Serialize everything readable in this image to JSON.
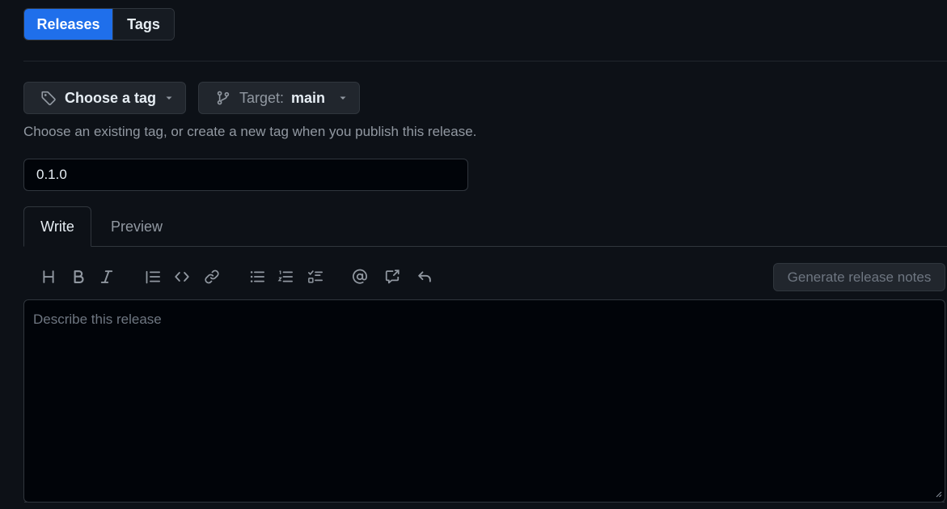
{
  "segmented": {
    "releases_label": "Releases",
    "tags_label": "Tags"
  },
  "tag_picker": {
    "label": "Choose a tag",
    "icon": "tag-icon"
  },
  "target_picker": {
    "prefix": "Target:",
    "value": "main",
    "icon": "git-branch-icon"
  },
  "hint": "Choose an existing tag, or create a new tag when you publish this release.",
  "title_input": {
    "value": "0.1.0"
  },
  "tabs": {
    "write": "Write",
    "preview": "Preview"
  },
  "toolbar": {
    "icons": [
      "heading-icon",
      "bold-icon",
      "italic-icon",
      "quote-icon",
      "code-icon",
      "link-icon",
      "unordered-list-icon",
      "ordered-list-icon",
      "task-list-icon",
      "mention-icon",
      "cross-reference-icon",
      "reply-icon"
    ]
  },
  "generate_button": "Generate release notes",
  "body_placeholder": "Describe this release",
  "colors": {
    "background": "#0d1117",
    "accent": "#1f6feb",
    "border": "#30363d"
  }
}
